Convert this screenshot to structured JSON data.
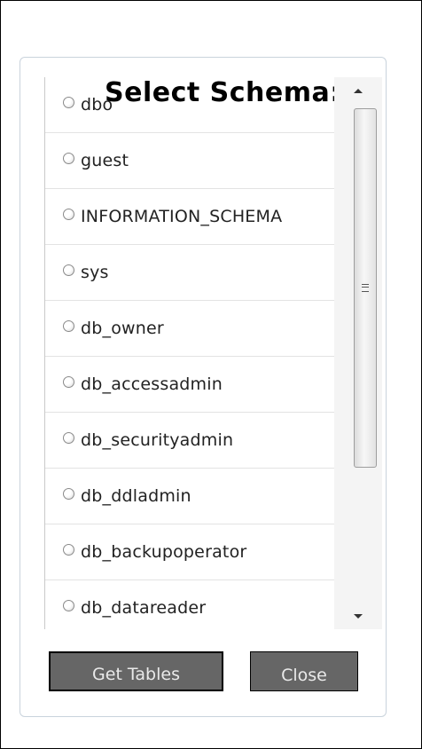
{
  "dialog": {
    "title": "Select Schema:"
  },
  "schemas": [
    {
      "label": "dbo"
    },
    {
      "label": "guest"
    },
    {
      "label": "INFORMATION_SCHEMA"
    },
    {
      "label": "sys"
    },
    {
      "label": "db_owner"
    },
    {
      "label": "db_accessadmin"
    },
    {
      "label": "db_securityadmin"
    },
    {
      "label": "db_ddladmin"
    },
    {
      "label": "db_backupoperator"
    },
    {
      "label": "db_datareader"
    }
  ],
  "buttons": {
    "get_tables": "Get Tables",
    "close": "Close"
  },
  "colors": {
    "button_bg": "#666666",
    "button_text": "#e9e9e9",
    "fieldset_border": "#c9d3dc"
  },
  "icons": {
    "scroll_up": "triangle-up-icon",
    "scroll_down": "triangle-down-icon",
    "scroll_grip": "grip-lines-icon",
    "radio": "radio-unchecked-icon"
  }
}
